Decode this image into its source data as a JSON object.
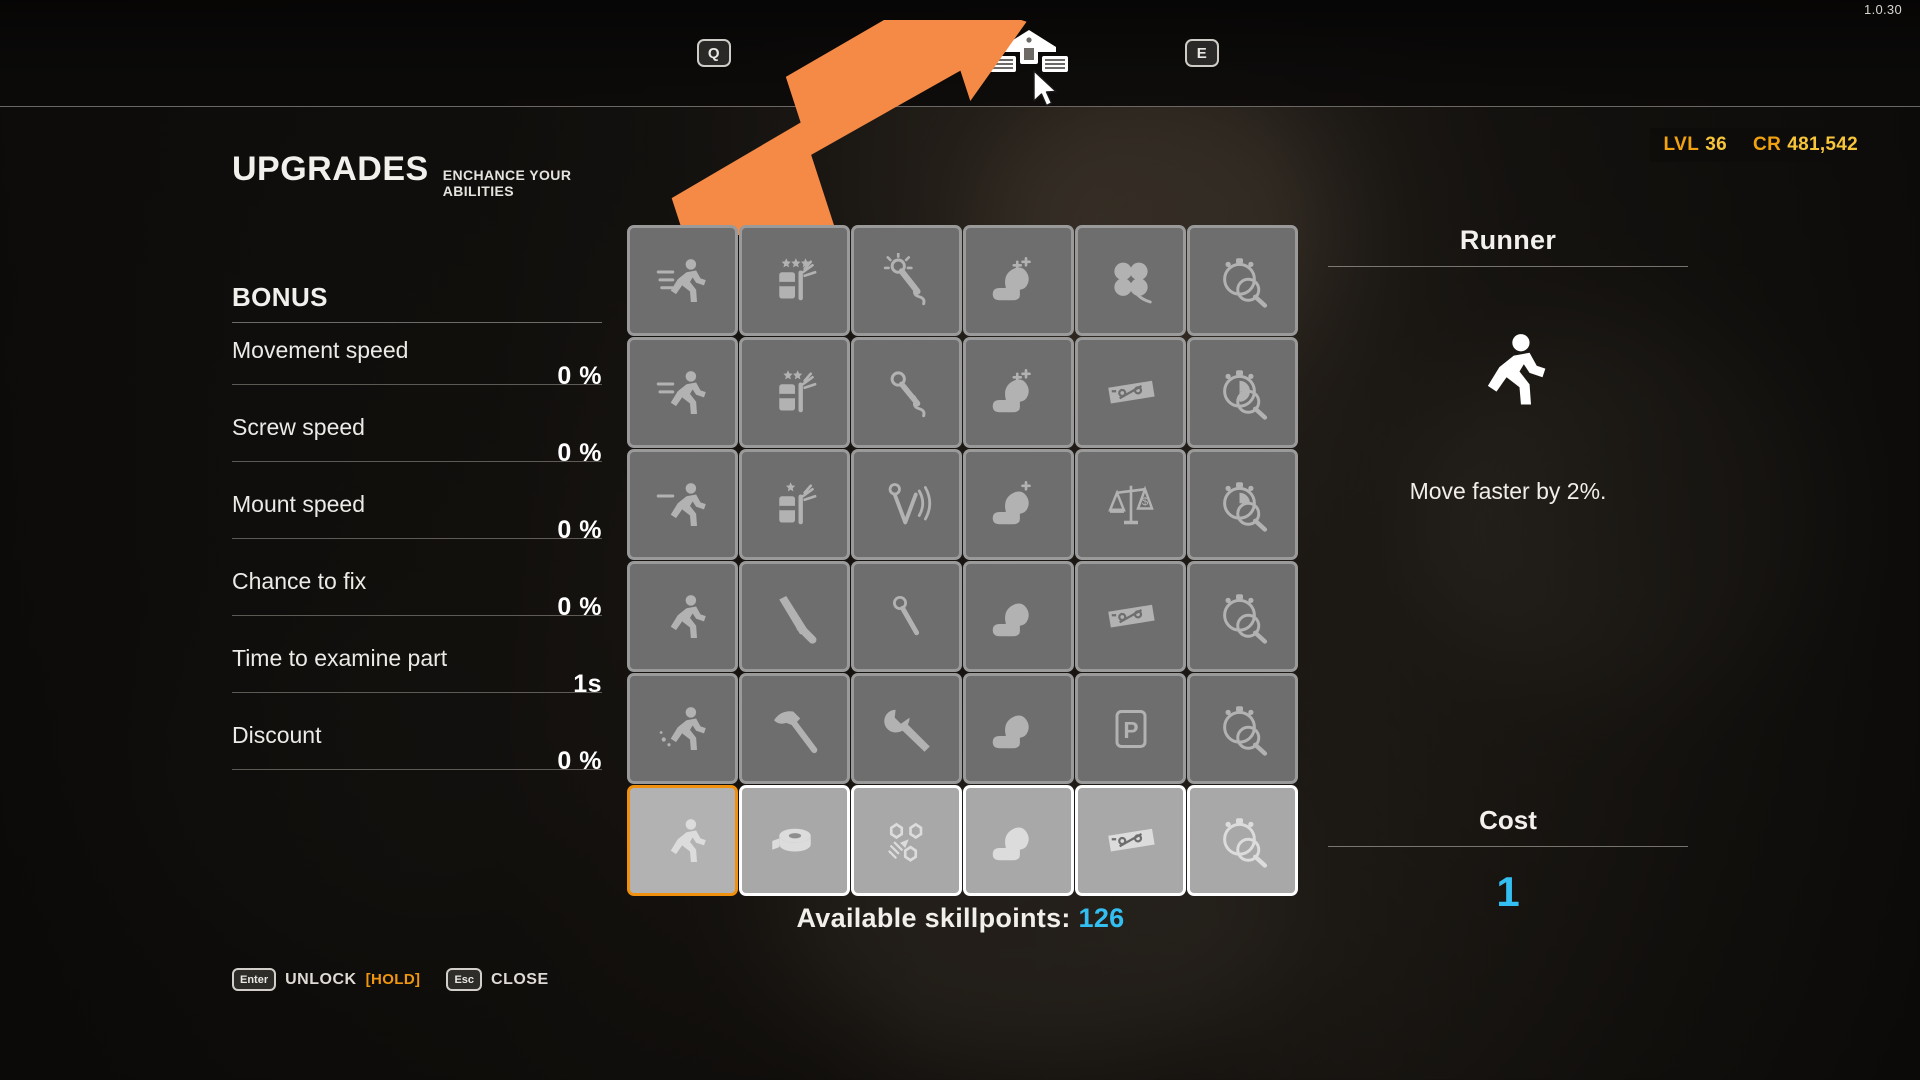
{
  "version": "1.0.30",
  "topbar": {
    "key_left": "Q",
    "key_right": "E",
    "nav_upgrades_icon": "upgrade-arrows-icon",
    "nav_garage_icon": "garage-icon",
    "cursor_icon": "mouse-cursor-icon"
  },
  "hud": {
    "level_label": "LVL",
    "level_value": "36",
    "credits_label": "CR",
    "credits_value": "481,542",
    "level_color": "#f0a210",
    "credits_color": "#f6c53a"
  },
  "header": {
    "title": "UPGRADES",
    "subtitle": "ENCHANCE YOUR ABILITIES"
  },
  "bonus": {
    "heading": "BONUS",
    "stats": [
      {
        "label": "Movement speed",
        "value": "0 %"
      },
      {
        "label": "Screw speed",
        "value": "0 %"
      },
      {
        "label": "Mount speed",
        "value": "0 %"
      },
      {
        "label": "Chance to fix",
        "value": "0 %"
      },
      {
        "label": "Time to examine part",
        "value": "1s"
      },
      {
        "label": "Discount",
        "value": "0 %"
      }
    ]
  },
  "hints": [
    {
      "key": "Enter",
      "text": "UNLOCK",
      "extra": "[HOLD]"
    },
    {
      "key": "Esc",
      "text": "CLOSE",
      "extra": ""
    }
  ],
  "grid": {
    "columns": 6,
    "rows": 6,
    "selected_index": 30,
    "cells": [
      {
        "icon": "runner-speed-lines-3-icon",
        "state": "locked"
      },
      {
        "icon": "welder-stars-3-icon",
        "state": "locked"
      },
      {
        "icon": "screw-star-burst-icon",
        "state": "locked"
      },
      {
        "icon": "bicep-plus-3-icon",
        "state": "locked"
      },
      {
        "icon": "four-leaf-clover-icon",
        "state": "locked"
      },
      {
        "icon": "stopwatch-magnifier-3-icon",
        "state": "locked"
      },
      {
        "icon": "runner-speed-lines-2-icon",
        "state": "locked"
      },
      {
        "icon": "welder-stars-2-icon",
        "state": "locked"
      },
      {
        "icon": "screw-spring-icon",
        "state": "locked"
      },
      {
        "icon": "bicep-plus-2-icon",
        "state": "locked"
      },
      {
        "icon": "discount-ticket-icon",
        "state": "locked"
      },
      {
        "icon": "stopwatch-magnifier-2-icon",
        "state": "locked"
      },
      {
        "icon": "runner-speed-lines-1-icon",
        "state": "locked"
      },
      {
        "icon": "welder-star-1-icon",
        "state": "locked"
      },
      {
        "icon": "screw-signal-icon",
        "state": "locked"
      },
      {
        "icon": "bicep-plus-1-icon",
        "state": "locked"
      },
      {
        "icon": "balance-scale-money-icon",
        "state": "locked"
      },
      {
        "icon": "stopwatch-magnifier-1-icon",
        "state": "locked"
      },
      {
        "icon": "runner-icon",
        "state": "locked"
      },
      {
        "icon": "screwdriver-icon",
        "state": "locked"
      },
      {
        "icon": "screw-plain-icon",
        "state": "locked"
      },
      {
        "icon": "bicep-icon",
        "state": "locked"
      },
      {
        "icon": "discount-ticket-icon",
        "state": "locked"
      },
      {
        "icon": "stopwatch-magnifier-icon",
        "state": "locked"
      },
      {
        "icon": "runner-sparks-icon",
        "state": "locked"
      },
      {
        "icon": "hammer-icon",
        "state": "locked"
      },
      {
        "icon": "wrench-icon",
        "state": "locked"
      },
      {
        "icon": "bicep-icon",
        "state": "locked"
      },
      {
        "icon": "parking-p-icon",
        "state": "locked"
      },
      {
        "icon": "stopwatch-magnifier-icon",
        "state": "locked"
      },
      {
        "icon": "runner-icon",
        "state": "selected"
      },
      {
        "icon": "tape-roll-icon",
        "state": "unlocked"
      },
      {
        "icon": "scattered-parts-icon",
        "state": "unlocked"
      },
      {
        "icon": "bicep-icon",
        "state": "unlocked"
      },
      {
        "icon": "discount-ticket-icon",
        "state": "unlocked"
      },
      {
        "icon": "stopwatch-magnifier-icon",
        "state": "unlocked"
      }
    ]
  },
  "skillpoints": {
    "label": "Available skillpoints:",
    "value": "126",
    "value_color": "#33bff2"
  },
  "detail": {
    "title": "Runner",
    "icon": "runner-icon",
    "description": "Move faster by 2%.",
    "cost_title": "Cost",
    "cost_value": "1",
    "cost_color": "#33bff2"
  }
}
